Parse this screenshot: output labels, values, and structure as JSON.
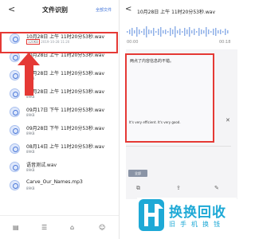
{
  "left": {
    "title": "文件识别",
    "header_action": "全部文件",
    "back_glyph": "<",
    "files": [
      {
        "name": "10月28日 上午 11时20分53秒.wav",
        "size": "120KB",
        "date": "2019-10-28 11:20"
      },
      {
        "name": "10月28日 上午 11时20分53秒.wav",
        "size": "",
        "date": ""
      },
      {
        "name": "10月28日 上午 11时20分53秒.wav",
        "size": "89KB",
        "date": ""
      },
      {
        "name": "10月28日 上午 11时20分53秒.wav",
        "size": "89KB",
        "date": ""
      },
      {
        "name": "09月17日 下午 11时20分53秒.wav",
        "size": "89KB",
        "date": ""
      },
      {
        "name": "09月28日 下午 11时20分53秒.wav",
        "size": "89KB",
        "date": ""
      },
      {
        "name": "08月14日 上午 11时20分53秒.wav",
        "size": "89KB",
        "date": ""
      },
      {
        "name": "语音测试.wav",
        "size": "89KB",
        "date": ""
      },
      {
        "name": "Carve_Our_Names.mp3",
        "size": "89KB",
        "date": ""
      }
    ],
    "bottom_icons": [
      "doc-icon",
      "list-icon",
      "home-icon",
      "user-icon"
    ]
  },
  "right": {
    "title": "10月28日 上午 11时20分53秒.wav",
    "back_glyph": "<",
    "time_start": "00:00",
    "time_end": "00:18",
    "text_cn": "两点了内容信息的不错。",
    "text_en": "It's very efficient. It's very good.",
    "close_glyph": "✕",
    "button_label": "全部",
    "bottom_icons": [
      "copy-icon",
      "share-icon",
      "edit-icon"
    ]
  },
  "watermark": {
    "big": "换换回收",
    "small": "旧手机换钱"
  },
  "colors": {
    "highlight": "#e53935",
    "brand": "#1ea9d6",
    "accent": "#3b6fd8"
  }
}
